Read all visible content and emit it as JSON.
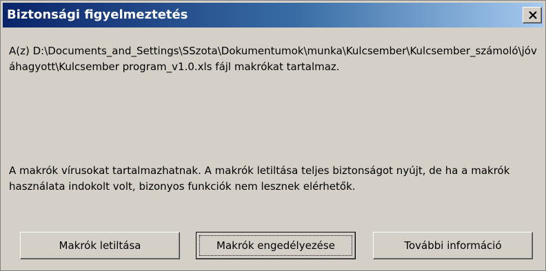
{
  "window": {
    "title": "Biztonsági figyelmeztetés",
    "close_icon": "close-icon"
  },
  "message": {
    "file_notice": "A(z) D:\\Documents_and_Settings\\SSzota\\Dokumentumok\\munka\\Kulcsember\\Kulcsember_számoló\\jóváhagyott\\Kulcsember program_v1.0.xls fájl makrókat tartalmaz.",
    "warning": "A makrók vírusokat tartalmazhatnak. A makrók letiltása teljes biztonságot nyújt, de ha a makrók használata indokolt volt, bizonyos funkciók nem lesznek elérhetők."
  },
  "buttons": {
    "disable_macros": "Makrók letiltása",
    "enable_macros": "Makrók engedélyezése",
    "more_info": "További információ"
  },
  "colors": {
    "title_gradient_start": "#0a246a",
    "title_gradient_end": "#a6caf0",
    "dialog_face": "#d4d0c8"
  }
}
